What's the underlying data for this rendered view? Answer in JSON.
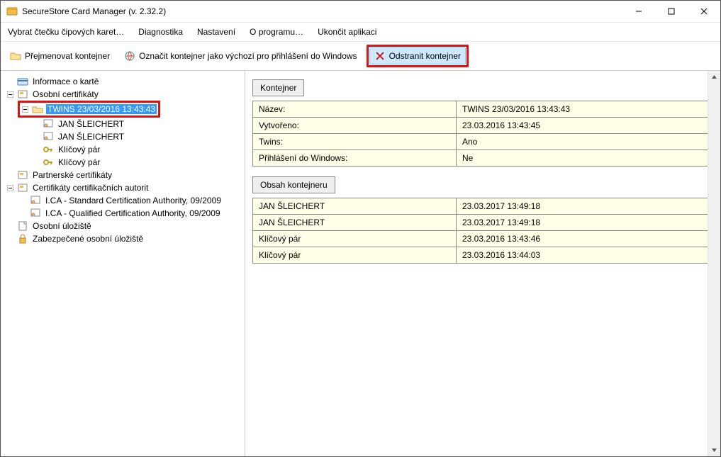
{
  "window": {
    "title": "SecureStore Card Manager (v. 2.32.2)"
  },
  "menu": {
    "select_reader": "Vybrat čtečku čipových karet…",
    "diagnostics": "Diagnostika",
    "settings": "Nastavení",
    "about": "O programu…",
    "quit": "Ukončit aplikaci"
  },
  "toolbar": {
    "rename": "Přejmenovat kontejner",
    "mark_default": "Označit kontejner jako výchozí pro přihlášení do Windows",
    "delete": "Odstranit kontejner"
  },
  "tree": {
    "card_info": "Informace o kartě",
    "personal_certs": "Osobní certifikáty",
    "twins_container": "TWINS 23/03/2016 13:43:43",
    "jan1": "JAN ŠLEICHERT",
    "jan2": "JAN ŠLEICHERT",
    "keypair1": "Klíčový pár",
    "keypair2": "Klíčový pár",
    "partner_certs": "Partnerské certifikáty",
    "ca_certs": "Certifikáty certifikačních autorit",
    "ica_std": "I.CA - Standard Certification Authority, 09/2009",
    "ica_qual": "I.CA - Qualified Certification Authority, 09/2009",
    "personal_store": "Osobní úložiště",
    "secure_store": "Zabezpečené osobní úložiště"
  },
  "detail": {
    "container_header": "Kontejner",
    "name_label": "Název:",
    "name_value": "TWINS 23/03/2016 13:43:43",
    "created_label": "Vytvořeno:",
    "created_value": "23.03.2016 13:43:45",
    "twins_label": "Twins:",
    "twins_value": "Ano",
    "winlogon_label": "Přihlášení do Windows:",
    "winlogon_value": "Ne",
    "content_header": "Obsah kontejneru",
    "rows": [
      {
        "name": "JAN ŠLEICHERT",
        "date": "23.03.2017 13:49:18"
      },
      {
        "name": "JAN ŠLEICHERT",
        "date": "23.03.2017 13:49:18"
      },
      {
        "name": "Klíčový pár",
        "date": "23.03.2016 13:43:46"
      },
      {
        "name": "Klíčový pár",
        "date": "23.03.2016 13:44:03"
      }
    ]
  }
}
